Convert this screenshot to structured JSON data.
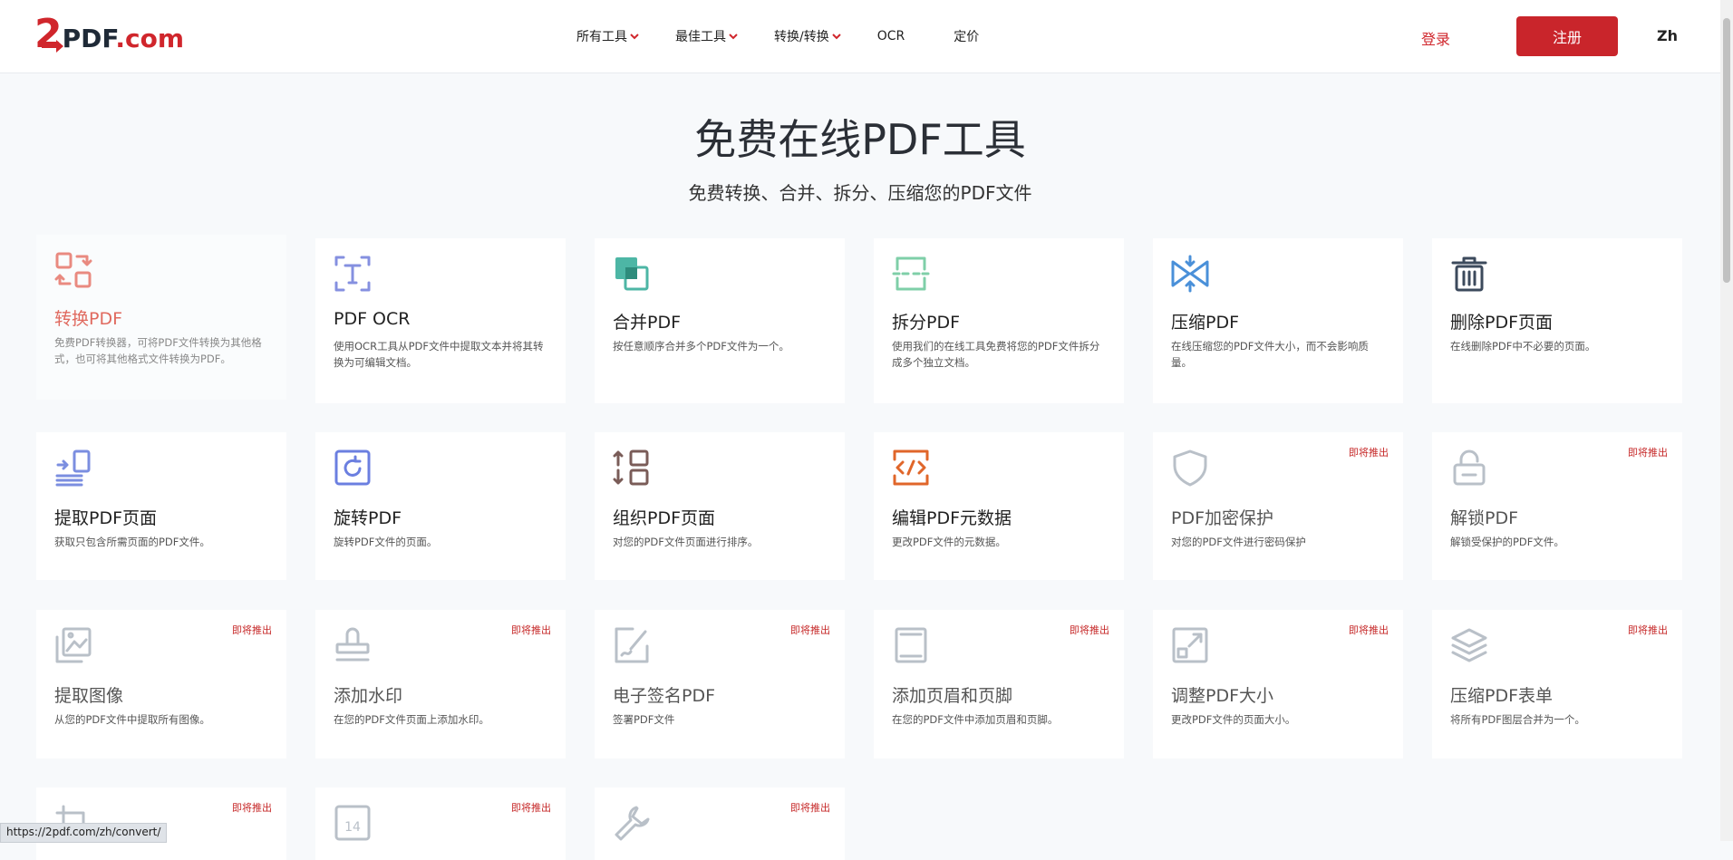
{
  "logo": {
    "two": "2",
    "text": "PDF",
    "dot_text": ".com"
  },
  "nav": [
    {
      "label": "所有工具",
      "dropdown": true
    },
    {
      "label": "最佳工具",
      "dropdown": true
    },
    {
      "label": "转换/转换",
      "dropdown": true
    },
    {
      "label": "OCR",
      "dropdown": false
    },
    {
      "label": "定价",
      "dropdown": false
    }
  ],
  "auth": {
    "login": "登录",
    "register": "注册"
  },
  "lang": "Zh",
  "hero": {
    "title": "免费在线PDF工具",
    "subtitle": "免费转换、合并、拆分、压缩您的PDF文件"
  },
  "soon_label": "即将推出",
  "cards": [
    {
      "title": "转换PDF",
      "desc": "免费PDF转换器，可将PDF文件转换为其他格式，也可将其他格式文件转换为PDF。",
      "icon": "convert-icon",
      "color": "#e98a80"
    },
    {
      "title": "PDF OCR",
      "desc": "使用OCR工具从PDF文件中提取文本并将其转换为可编辑文档。",
      "icon": "ocr-icon",
      "color": "#8590e0"
    },
    {
      "title": "合并PDF",
      "desc": "按任意顺序合并多个PDF文件为一个。",
      "icon": "merge-icon",
      "color": "#4db6a5"
    },
    {
      "title": "拆分PDF",
      "desc": "使用我们的在线工具免费将您的PDF文件拆分成多个独立文档。",
      "icon": "split-icon",
      "color": "#7fcfa8"
    },
    {
      "title": "压缩PDF",
      "desc": "在线压缩您的PDF文件大小，而不会影响质量。",
      "icon": "compress-icon",
      "color": "#4a90d9"
    },
    {
      "title": "删除PDF页面",
      "desc": "在线删除PDF中不必要的页面。",
      "icon": "trash-icon",
      "color": "#3c4a5c"
    },
    {
      "title": "提取PDF页面",
      "desc": "获取只包含所需页面的PDF文件。",
      "icon": "extract-pages-icon",
      "color": "#7b8ee0"
    },
    {
      "title": "旋转PDF",
      "desc": "旋转PDF文件的页面。",
      "icon": "rotate-icon",
      "color": "#6b7fe0"
    },
    {
      "title": "组织PDF页面",
      "desc": "对您的PDF文件页面进行排序。",
      "icon": "organize-icon",
      "color": "#7a5c58"
    },
    {
      "title": "编辑PDF元数据",
      "desc": "更改PDF文件的元数据。",
      "icon": "code-icon",
      "color": "#e0662a"
    },
    {
      "title": "PDF加密保护",
      "desc": "对您的PDF文件进行密码保护",
      "icon": "shield-icon",
      "color": "#b9c0c8",
      "soon": true
    },
    {
      "title": "解锁PDF",
      "desc": "解锁受保护的PDF文件。",
      "icon": "unlock-icon",
      "color": "#b9c0c8",
      "soon": true
    },
    {
      "title": "提取图像",
      "desc": "从您的PDF文件中提取所有图像。",
      "icon": "image-icon",
      "color": "#b9c0c8",
      "soon": true
    },
    {
      "title": "添加水印",
      "desc": "在您的PDF文件页面上添加水印。",
      "icon": "stamp-icon",
      "color": "#b9c0c8",
      "soon": true
    },
    {
      "title": "电子签名PDF",
      "desc": "签署PDF文件",
      "icon": "signature-icon",
      "color": "#b9c0c8",
      "soon": true
    },
    {
      "title": "添加页眉和页脚",
      "desc": "在您的PDF文件中添加页眉和页脚。",
      "icon": "header-footer-icon",
      "color": "#b9c0c8",
      "soon": true
    },
    {
      "title": "调整PDF大小",
      "desc": "更改PDF文件的页面大小。",
      "icon": "resize-icon",
      "color": "#b9c0c8",
      "soon": true
    },
    {
      "title": "压缩PDF表单",
      "desc": "将所有PDF图层合并为一个。",
      "icon": "layers-icon",
      "color": "#b9c0c8",
      "soon": true
    },
    {
      "title": "",
      "desc": "",
      "icon": "crop-icon",
      "color": "#b9c0c8",
      "soon": true
    },
    {
      "title": "",
      "desc": "",
      "icon": "page-number-icon",
      "number": "14",
      "color": "#b9c0c8",
      "soon": true
    },
    {
      "title": "",
      "desc": "",
      "icon": "wrench-icon",
      "color": "#b9c0c8",
      "soon": true
    }
  ],
  "status_url": "https://2pdf.com/zh/convert/"
}
